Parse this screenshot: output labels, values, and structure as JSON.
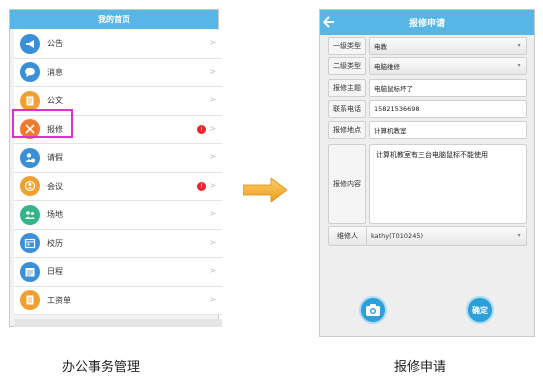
{
  "left_screen": {
    "header_title": "我的首页",
    "menu_items": [
      {
        "label": "公告",
        "icon": "megaphone-icon",
        "color": "#3a8fd9"
      },
      {
        "label": "消息",
        "icon": "chat-bubble-icon",
        "color": "#3a8fd9"
      },
      {
        "label": "公文",
        "icon": "document-icon",
        "color": "#f0a030"
      },
      {
        "label": "报修",
        "icon": "wrench-screwdriver-icon",
        "color": "#ef7a2e",
        "badge": "!"
      },
      {
        "label": "请假",
        "icon": "person-clock-icon",
        "color": "#3a8fd9"
      },
      {
        "label": "会议",
        "icon": "meeting-icon",
        "color": "#f0a030",
        "badge": "!"
      },
      {
        "label": "场地",
        "icon": "people-icon",
        "color": "#35b38a"
      },
      {
        "label": "校历",
        "icon": "calendar-icon",
        "color": "#3a8fd9"
      },
      {
        "label": "日程",
        "icon": "schedule-icon",
        "color": "#3a8fd9"
      },
      {
        "label": "工资单",
        "icon": "payslip-icon",
        "color": "#f0a030"
      }
    ],
    "chevron": ">",
    "highlight_color": "#e02fcf"
  },
  "right_screen": {
    "header_title": "报修申请",
    "back_icon": "arrow-left-icon",
    "fields": {
      "level1_type": {
        "label": "一级类型",
        "value": "电教"
      },
      "level2_type": {
        "label": "二级类型",
        "value": "电脑维修"
      },
      "subject": {
        "label": "报修主题",
        "value": "电脑鼠标坏了"
      },
      "phone": {
        "label": "联系电话",
        "value": "15821536698"
      },
      "location": {
        "label": "报修地点",
        "value": "计算机教室"
      },
      "content": {
        "label": "报修内容",
        "value": "计算机教室有三台电脑鼠标不能使用"
      },
      "reporter": {
        "label": "维修人",
        "value": "kathy(T010245)"
      }
    },
    "camera_icon": "camera-icon",
    "confirm_label": "确定"
  },
  "arrow_color": "#f0a020",
  "captions": {
    "left": "办公事务管理",
    "right": "报修申请"
  }
}
